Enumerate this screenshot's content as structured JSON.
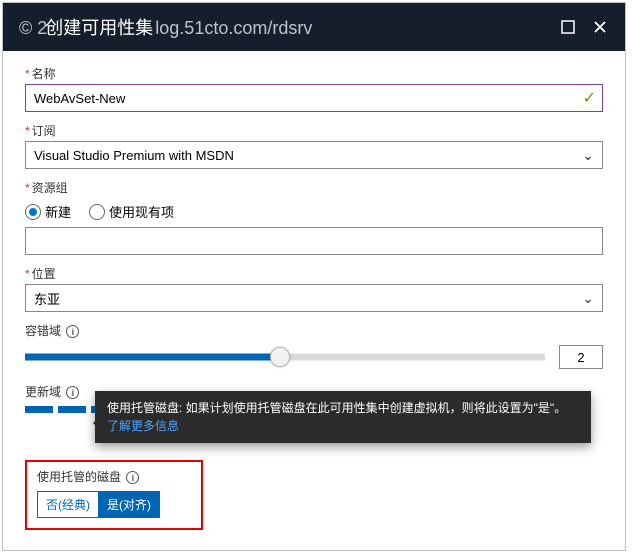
{
  "header": {
    "watermark_prefix": "©  2",
    "blade_title": "创建可用性集",
    "watermark_suffix": "log.51cto.com/rdsrv"
  },
  "name": {
    "label": "名称",
    "value": "WebAvSet-New"
  },
  "subscription": {
    "label": "订阅",
    "value": "Visual Studio Premium with MSDN"
  },
  "resource_group": {
    "label": "资源组",
    "option_new": "新建",
    "option_existing": "使用现有项",
    "value": ""
  },
  "location": {
    "label": "位置",
    "value": "东亚"
  },
  "fault_domain": {
    "label": "容错域",
    "value": "2"
  },
  "update_domain": {
    "label": "更新域"
  },
  "managed_disks": {
    "label": "使用托管的磁盘",
    "option_no": "否(经典)",
    "option_yes": "是(对齐)"
  },
  "tooltip": {
    "text": "使用托管磁盘: 如果计划使用托管磁盘在此可用性集中创建虚拟机，则将此设置为\"是\"。",
    "link": "了解更多信息"
  }
}
